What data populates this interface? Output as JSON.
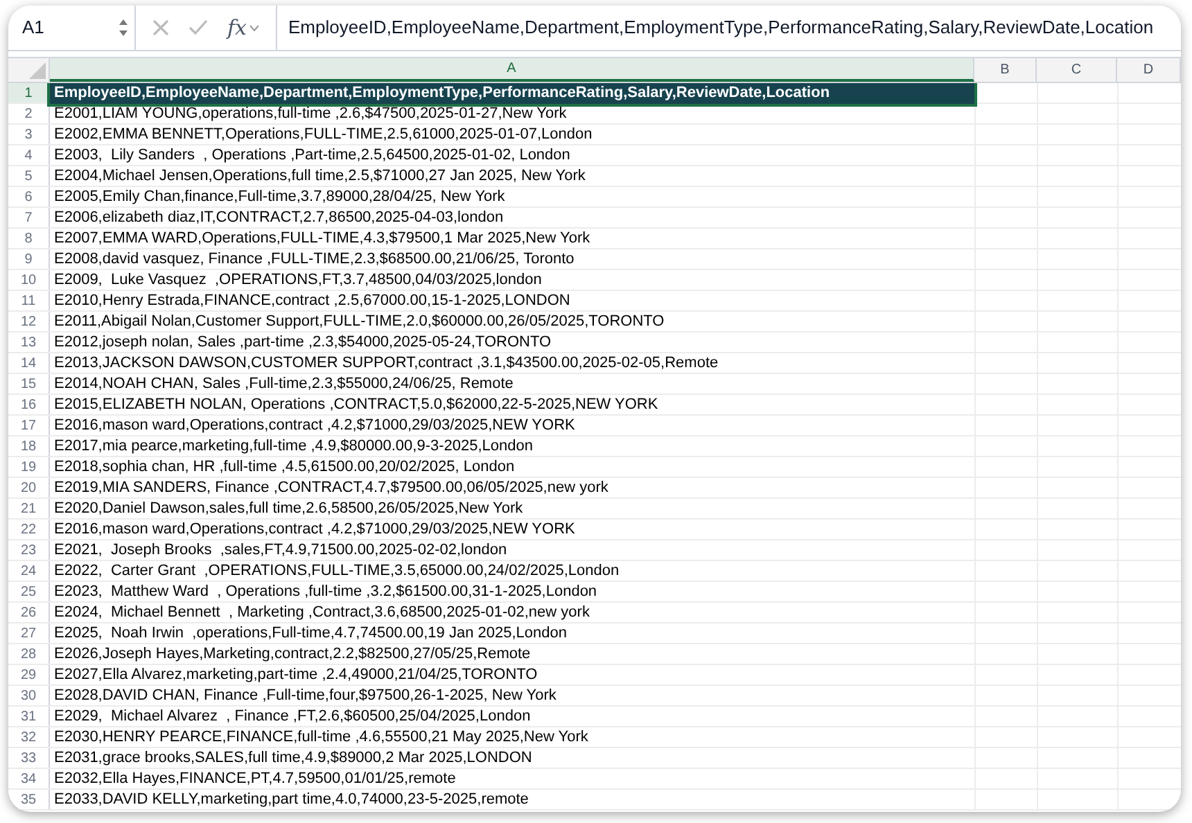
{
  "name_box": "A1",
  "function_button": {
    "label": "fx"
  },
  "formula_bar": {
    "value": "EmployeeID,EmployeeName,Department,EmploymentType,PerformanceRating,Salary,ReviewDate,Location"
  },
  "columns": [
    {
      "label": "A",
      "selected": true
    },
    {
      "label": "B",
      "selected": false
    },
    {
      "label": "C",
      "selected": false
    },
    {
      "label": "D",
      "selected": false
    }
  ],
  "rows": [
    {
      "number": "1",
      "text": "EmployeeID,EmployeeName,Department,EmploymentType,PerformanceRating,Salary,ReviewDate,Location",
      "selected": true
    },
    {
      "number": "2",
      "text": "E2001,LIAM YOUNG,operations,full-time ,2.6,$47500,2025-01-27,New York",
      "selected": false
    },
    {
      "number": "3",
      "text": "E2002,EMMA BENNETT,Operations,FULL-TIME,2.5,61000,2025-01-07,London",
      "selected": false
    },
    {
      "number": "4",
      "text": "E2003,  Lily Sanders  , Operations ,Part-time,2.5,64500,2025-01-02, London",
      "selected": false
    },
    {
      "number": "5",
      "text": "E2004,Michael Jensen,Operations,full time,2.5,$71000,27 Jan 2025, New York",
      "selected": false
    },
    {
      "number": "6",
      "text": "E2005,Emily Chan,finance,Full-time,3.7,89000,28/04/25, New York",
      "selected": false
    },
    {
      "number": "7",
      "text": "E2006,elizabeth diaz,IT,CONTRACT,2.7,86500,2025-04-03,london",
      "selected": false
    },
    {
      "number": "8",
      "text": "E2007,EMMA WARD,Operations,FULL-TIME,4.3,$79500,1 Mar 2025,New York",
      "selected": false
    },
    {
      "number": "9",
      "text": "E2008,david vasquez, Finance ,FULL-TIME,2.3,$68500.00,21/06/25, Toronto",
      "selected": false
    },
    {
      "number": "10",
      "text": "E2009,  Luke Vasquez  ,OPERATIONS,FT,3.7,48500,04/03/2025,london",
      "selected": false
    },
    {
      "number": "11",
      "text": "E2010,Henry Estrada,FINANCE,contract ,2.5,67000.00,15-1-2025,LONDON",
      "selected": false
    },
    {
      "number": "12",
      "text": "E2011,Abigail Nolan,Customer Support,FULL-TIME,2.0,$60000.00,26/05/2025,TORONTO",
      "selected": false
    },
    {
      "number": "13",
      "text": "E2012,joseph nolan, Sales ,part-time ,2.3,$54000,2025-05-24,TORONTO",
      "selected": false
    },
    {
      "number": "14",
      "text": "E2013,JACKSON DAWSON,CUSTOMER SUPPORT,contract ,3.1,$43500.00,2025-02-05,Remote",
      "selected": false
    },
    {
      "number": "15",
      "text": "E2014,NOAH CHAN, Sales ,Full-time,2.3,$55000,24/06/25, Remote",
      "selected": false
    },
    {
      "number": "16",
      "text": "E2015,ELIZABETH NOLAN, Operations ,CONTRACT,5.0,$62000,22-5-2025,NEW YORK",
      "selected": false
    },
    {
      "number": "17",
      "text": "E2016,mason ward,Operations,contract ,4.2,$71000,29/03/2025,NEW YORK",
      "selected": false
    },
    {
      "number": "18",
      "text": "E2017,mia pearce,marketing,full-time ,4.9,$80000.00,9-3-2025,London",
      "selected": false
    },
    {
      "number": "19",
      "text": "E2018,sophia chan, HR ,full-time ,4.5,61500.00,20/02/2025, London",
      "selected": false
    },
    {
      "number": "20",
      "text": "E2019,MIA SANDERS, Finance ,CONTRACT,4.7,$79500.00,06/05/2025,new york",
      "selected": false
    },
    {
      "number": "21",
      "text": "E2020,Daniel Dawson,sales,full time,2.6,58500,26/05/2025,New York",
      "selected": false
    },
    {
      "number": "22",
      "text": "E2016,mason ward,Operations,contract ,4.2,$71000,29/03/2025,NEW YORK",
      "selected": false
    },
    {
      "number": "23",
      "text": "E2021,  Joseph Brooks  ,sales,FT,4.9,71500.00,2025-02-02,london",
      "selected": false
    },
    {
      "number": "24",
      "text": "E2022,  Carter Grant  ,OPERATIONS,FULL-TIME,3.5,65000.00,24/02/2025,London",
      "selected": false
    },
    {
      "number": "25",
      "text": "E2023,  Matthew Ward  , Operations ,full-time ,3.2,$61500.00,31-1-2025,London",
      "selected": false
    },
    {
      "number": "26",
      "text": "E2024,  Michael Bennett  , Marketing ,Contract,3.6,68500,2025-01-02,new york",
      "selected": false
    },
    {
      "number": "27",
      "text": "E2025,  Noah Irwin  ,operations,Full-time,4.7,74500.00,19 Jan 2025,London",
      "selected": false
    },
    {
      "number": "28",
      "text": "E2026,Joseph Hayes,Marketing,contract,2.2,$82500,27/05/25,Remote",
      "selected": false
    },
    {
      "number": "29",
      "text": "E2027,Ella Alvarez,marketing,part-time ,2.4,49000,21/04/25,TORONTO",
      "selected": false
    },
    {
      "number": "30",
      "text": "E2028,DAVID CHAN, Finance ,Full-time,four,$97500,26-1-2025, New York",
      "selected": false
    },
    {
      "number": "31",
      "text": "E2029,  Michael Alvarez  , Finance ,FT,2.6,$60500,25/04/2025,London",
      "selected": false
    },
    {
      "number": "32",
      "text": "E2030,HENRY PEARCE,FINANCE,full-time ,4.6,55500,21 May 2025,New York",
      "selected": false
    },
    {
      "number": "33",
      "text": "E2031,grace brooks,SALES,full time,4.9,$89000,2 Mar 2025,LONDON",
      "selected": false
    },
    {
      "number": "34",
      "text": "E2032,Ella Hayes,FINANCE,PT,4.7,59500,01/01/25,remote",
      "selected": false
    },
    {
      "number": "35",
      "text": "E2033,DAVID KELLY,marketing,part time,4.0,74000,23-5-2025,remote",
      "selected": false
    }
  ]
}
